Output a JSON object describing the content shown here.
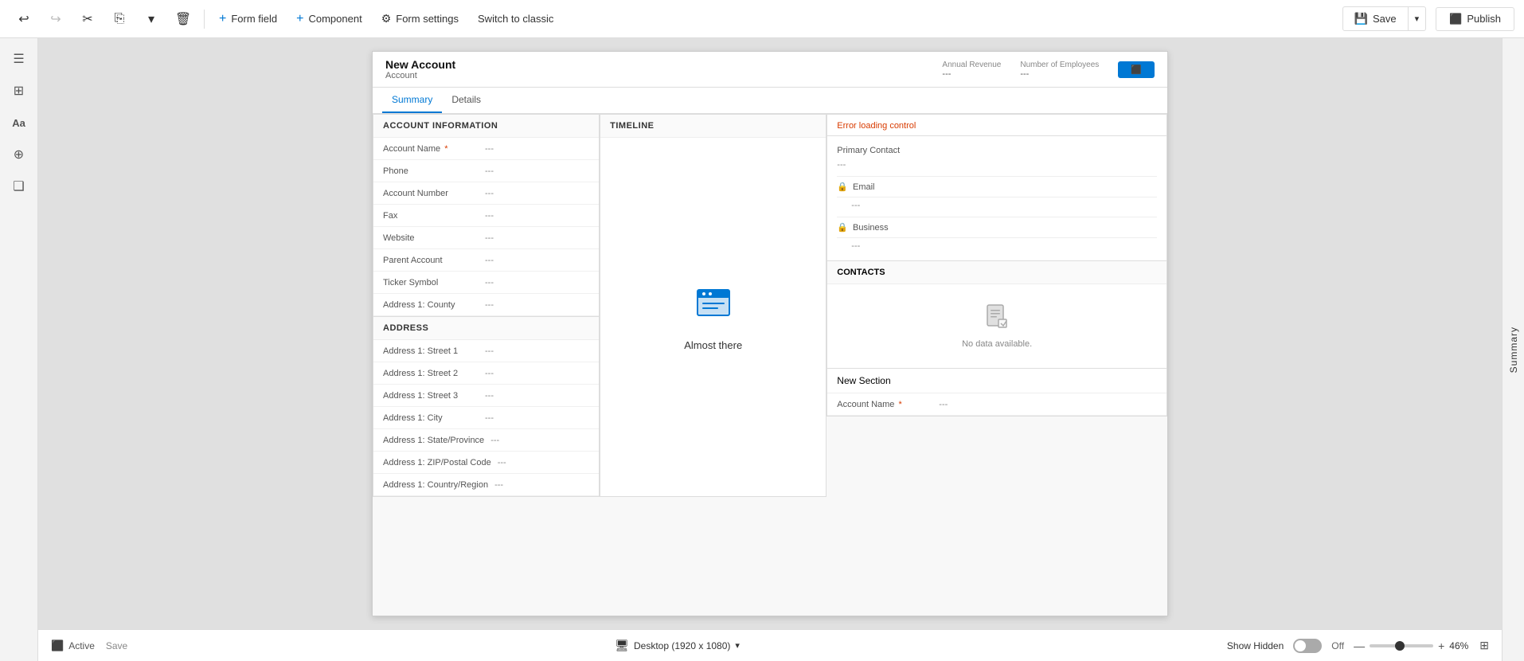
{
  "toolbar": {
    "undo_label": "↩",
    "redo_label": "↪",
    "cut_label": "✂",
    "copy_label": "⎘",
    "dropdown_label": "▾",
    "delete_label": "🗑",
    "form_field_label": "Form field",
    "component_label": "Component",
    "form_settings_label": "Form settings",
    "switch_classic_label": "Switch to classic",
    "save_label": "Save",
    "publish_label": "Publish"
  },
  "sidebar": {
    "icons": [
      "☰",
      "⊞",
      "Aa",
      "⊕",
      "❑"
    ]
  },
  "form": {
    "record_title": "New Account",
    "record_subtitle": "Account",
    "header_field1_label": "Annual Revenue",
    "header_field1_value": "---",
    "header_field2_label": "Number of Employees",
    "header_field2_value": "---",
    "tabs": [
      "Summary",
      "Details"
    ],
    "active_tab": "Summary",
    "sections": {
      "account_info": {
        "title": "ACCOUNT INFORMATION",
        "fields": [
          {
            "label": "Account Name",
            "required": true,
            "value": "---"
          },
          {
            "label": "Phone",
            "required": false,
            "value": "---"
          },
          {
            "label": "Account Number",
            "required": false,
            "value": "---"
          },
          {
            "label": "Fax",
            "required": false,
            "value": "---"
          },
          {
            "label": "Website",
            "required": false,
            "value": "---"
          },
          {
            "label": "Parent Account",
            "required": false,
            "value": "---"
          },
          {
            "label": "Ticker Symbol",
            "required": false,
            "value": "---"
          },
          {
            "label": "Address 1: County",
            "required": false,
            "value": "---"
          }
        ]
      },
      "address": {
        "title": "ADDRESS",
        "fields": [
          {
            "label": "Address 1: Street 1",
            "required": false,
            "value": "---"
          },
          {
            "label": "Address 1: Street 2",
            "required": false,
            "value": "---"
          },
          {
            "label": "Address 1: Street 3",
            "required": false,
            "value": "---"
          },
          {
            "label": "Address 1: City",
            "required": false,
            "value": "---"
          },
          {
            "label": "Address 1: State/Province",
            "required": false,
            "value": "---"
          },
          {
            "label": "Address 1: ZIP/Postal Code",
            "required": false,
            "value": "---"
          },
          {
            "label": "Address 1: Country/Region",
            "required": false,
            "value": "---"
          }
        ]
      },
      "timeline": {
        "title": "Timeline",
        "icon": "📁",
        "text": "Almost there"
      },
      "right_top": {
        "error_text": "Error loading control",
        "primary_contact_label": "Primary Contact",
        "primary_contact_value": "---",
        "email_label": "Email",
        "email_value": "---",
        "business_label": "Business",
        "business_value": "---"
      },
      "contacts": {
        "title": "CONTACTS",
        "no_data_text": "No data available."
      },
      "new_section": {
        "title": "New Section",
        "field_label": "Account Name",
        "field_required": true,
        "field_value": "---"
      }
    }
  },
  "bottom_bar": {
    "status_text": "Active",
    "save_label": "Save",
    "device_label": "Desktop (1920 x 1080)",
    "show_hidden_label": "Show Hidden",
    "toggle_state": "Off",
    "zoom_percent": "46%"
  },
  "right_panel": {
    "label": "Summary",
    "close_icon": "❯"
  }
}
